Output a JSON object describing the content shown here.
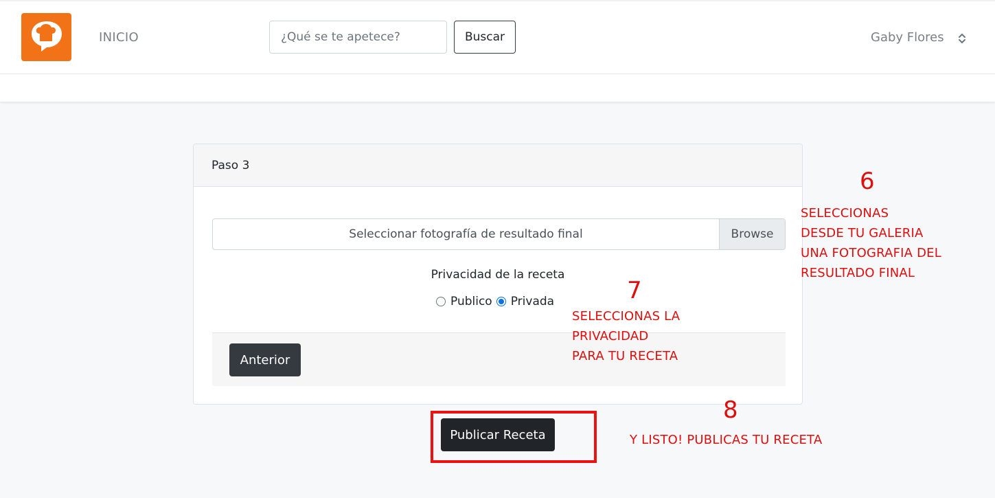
{
  "header": {
    "logo_alt": "chef-hat-logo",
    "home_label": "INICIO",
    "search": {
      "placeholder": "¿Qué se te apetece?",
      "button_label": "Buscar"
    },
    "user_name": "Gaby Flores"
  },
  "card": {
    "title": "Paso 3",
    "file_label": "Seleccionar fotografía de resultado final",
    "browse_label": "Browse",
    "privacy_title": "Privacidad de la receta",
    "privacy_options": [
      {
        "label": "Publico",
        "checked": false
      },
      {
        "label": "Privada",
        "checked": true
      }
    ],
    "prev_button": "Anterior"
  },
  "publish_button": "Publicar Receta",
  "annotations": {
    "step6": {
      "number": "6",
      "text": "SELECCIONAS\nDESDE TU GALERIA\nUNA FOTOGRAFIA DEL\nRESULTADO FINAL"
    },
    "step7": {
      "number": "7",
      "text": "SELECCIONAS LA\nPRIVACIDAD\nPARA TU RECETA"
    },
    "step8": {
      "number": "8",
      "text": "Y LISTO! PUBLICAS TU RECETA"
    }
  },
  "colors": {
    "brand": "#f27317",
    "annotation": "#e00d0d",
    "dark_button": "#343a40"
  }
}
